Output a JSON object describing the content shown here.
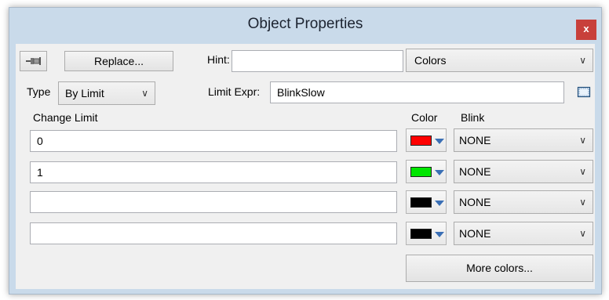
{
  "window": {
    "title": "Object Properties",
    "close_label": "x"
  },
  "toolbar": {
    "pin_icon": "pushpin-icon",
    "replace_label": "Replace...",
    "hint_label": "Hint:",
    "hint_value": "",
    "colors_combo_value": "Colors"
  },
  "type_row": {
    "type_label": "Type",
    "type_value": "By Limit",
    "limit_expr_label": "Limit Expr:",
    "limit_expr_value": "BlinkSlow",
    "browse_icon": "expression-browse-icon"
  },
  "headers": {
    "change_limit": "Change Limit",
    "color": "Color",
    "blink": "Blink"
  },
  "rows": [
    {
      "limit": "0",
      "color": "#ff0000",
      "blink": "NONE"
    },
    {
      "limit": "1",
      "color": "#00e600",
      "blink": "NONE"
    },
    {
      "limit": "",
      "color": "#000000",
      "blink": "NONE"
    },
    {
      "limit": "",
      "color": "#000000",
      "blink": "NONE"
    }
  ],
  "more_colors_label": "More colors...",
  "colors": {
    "close_button": "#c8403b",
    "window_frame": "#c9daea",
    "swatch_arrow": "#3a6fb5"
  }
}
